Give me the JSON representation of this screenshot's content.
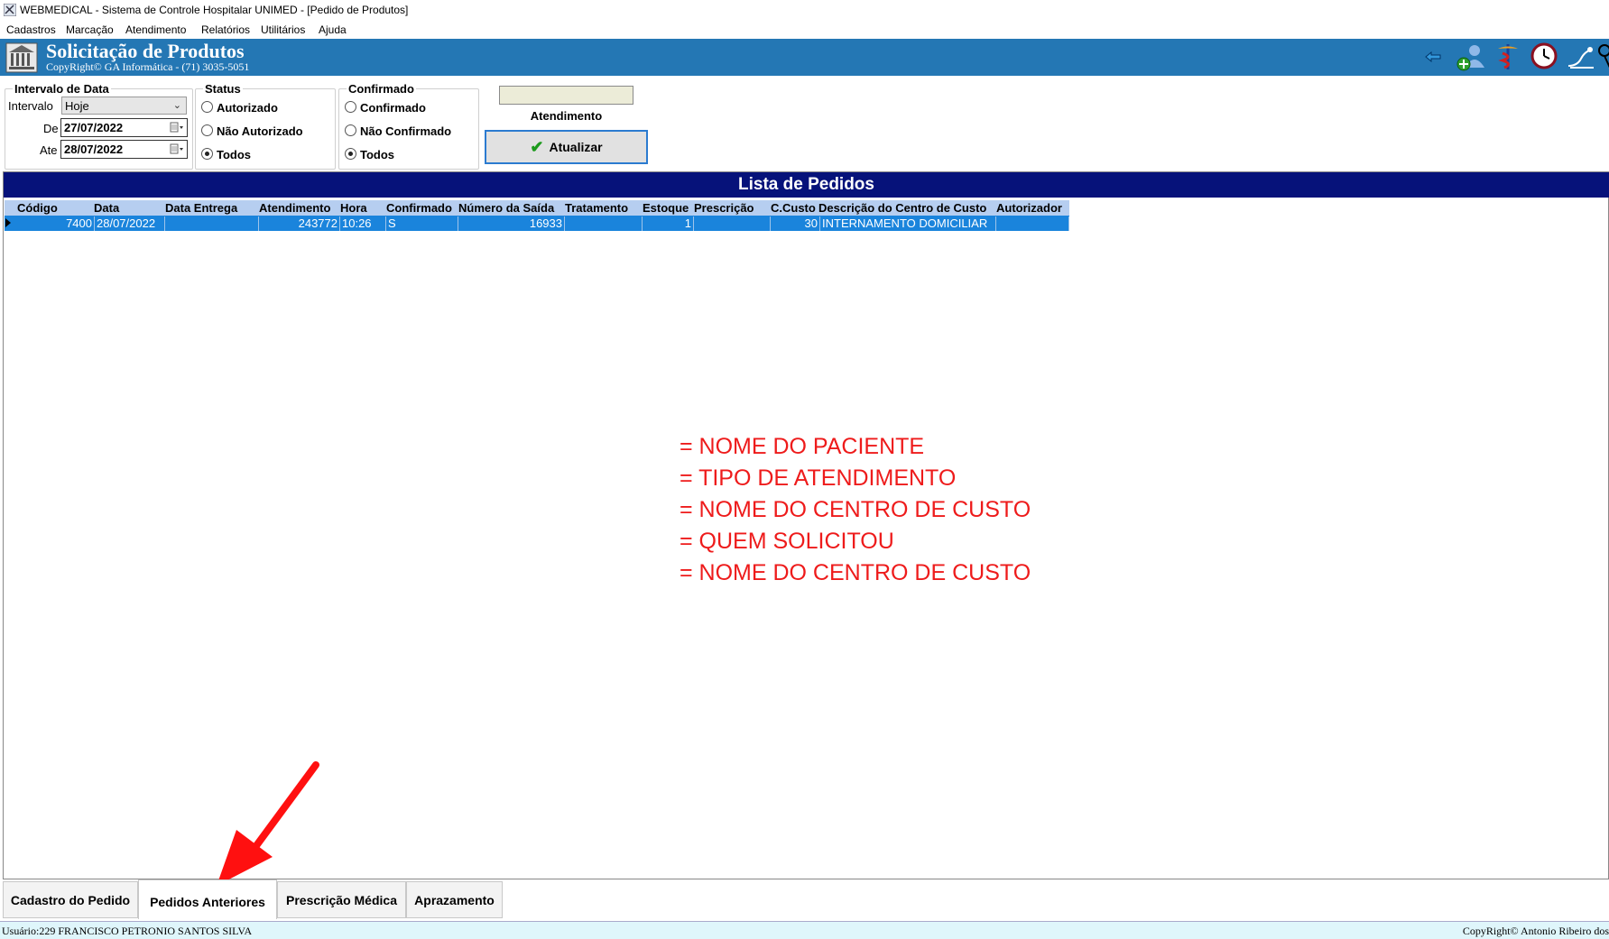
{
  "window": {
    "title": "WEBMEDICAL - Sistema de Controle Hospitalar UNIMED - [Pedido de Produtos]"
  },
  "menu": [
    {
      "label": "Cadastros"
    },
    {
      "label": "Marcação"
    },
    {
      "label": "Atendimento"
    },
    {
      "label": "Relatórios"
    },
    {
      "label": "Utilitários"
    },
    {
      "label": "Ajuda"
    }
  ],
  "banner": {
    "title": "Solicitação de Produtos",
    "subtitle": "CopyRight© GA Informática - (71) 3035-5051",
    "color": "#2477b4",
    "icons": [
      "back-arrow-icon",
      "add-user-icon",
      "caduceus-icon",
      "clock-icon",
      "key-icon"
    ]
  },
  "filters": {
    "date_interval": {
      "title": "Intervalo de Data",
      "interval_label": "Intervalo",
      "interval_value": "Hoje",
      "from_label": "De",
      "from_value": "27/07/2022",
      "to_label": "Ate",
      "to_value": "28/07/2022"
    },
    "status": {
      "title": "Status",
      "options": [
        "Autorizado",
        "Não Autorizado",
        "Todos"
      ],
      "selected": "Todos"
    },
    "confirmed": {
      "title": "Confirmado",
      "options": [
        "Confirmado",
        "Não Confirmado",
        "Todos"
      ],
      "selected": "Todos"
    },
    "atendimento_label": "Atendimento",
    "atendimento_value": "",
    "refresh_label": "Atualizar"
  },
  "list": {
    "title": "Lista de Pedidos",
    "title_color": "#06127a",
    "columns": [
      "Código",
      "Data",
      "Data Entrega",
      "Atendimento",
      "Hora",
      "Confirmado",
      "Número da Saída",
      "Tratamento",
      "Estoque",
      "Prescrição",
      "C.Custo",
      "Descrição do Centro de Custo",
      "Autorizador"
    ],
    "rows": [
      [
        "7400",
        "28/07/2022",
        "",
        "243772",
        "10:26",
        "S",
        "16933",
        "",
        "1",
        "",
        "30",
        "INTERNAMENTO DOMICILIAR",
        ""
      ]
    ],
    "selected_row_color": "#1a84dc"
  },
  "annotations": {
    "color": "#ee1b1b",
    "lines": [
      "= NOME DO PACIENTE",
      "= TIPO DE ATENDIMENTO",
      "= NOME DO CENTRO DE CUSTO",
      "= QUEM SOLICITOU",
      "= NOME DO CENTRO DE CUSTO"
    ]
  },
  "tabs": [
    {
      "label": "Cadastro do Pedido",
      "active": false
    },
    {
      "label": "Pedidos Anteriores",
      "active": true
    },
    {
      "label": "Prescrição Médica",
      "active": false
    },
    {
      "label": "Aprazamento",
      "active": false
    }
  ],
  "statusbar": {
    "user": "Usuário:229 FRANCISCO PETRONIO SANTOS SILVA",
    "copyright": "CopyRight© Antonio Ribeiro dos"
  }
}
